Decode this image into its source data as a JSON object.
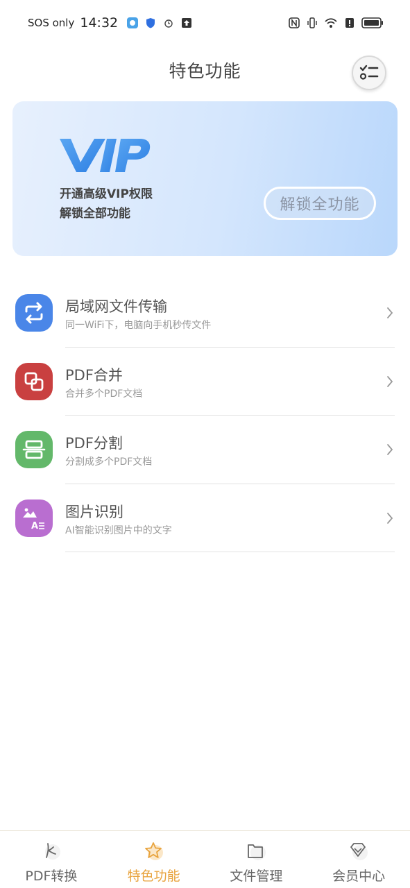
{
  "status_bar": {
    "carrier": "SOS only",
    "time": "14:32"
  },
  "header": {
    "title": "特色功能",
    "task_icon": "checklist-icon"
  },
  "vip_banner": {
    "logo_text": "VIP",
    "line1": "开通高级VIP权限",
    "line2": "解锁全部功能",
    "unlock_label": "解锁全功能"
  },
  "features": [
    {
      "name": "局域网文件传输",
      "desc": "同一WiFi下，电脑向手机秒传文件",
      "icon": "transfer-icon",
      "color": "#4a86e8"
    },
    {
      "name": "PDF合并",
      "desc": "合并多个PDF文档",
      "icon": "merge-icon",
      "color": "#c94040"
    },
    {
      "name": "PDF分割",
      "desc": "分割成多个PDF文档",
      "icon": "split-icon",
      "color": "#63b86a"
    },
    {
      "name": "图片识别",
      "desc": "AI智能识别图片中的文字",
      "icon": "image-ocr-icon",
      "color": "#b96ed0"
    }
  ],
  "bottom_nav": [
    {
      "label": "PDF转换",
      "icon": "pdf-convert-icon",
      "active": false
    },
    {
      "label": "特色功能",
      "icon": "star-icon",
      "active": true
    },
    {
      "label": "文件管理",
      "icon": "folder-icon",
      "active": false
    },
    {
      "label": "会员中心",
      "icon": "diamond-icon",
      "active": false
    }
  ],
  "colors": {
    "accent": "#e8a33d",
    "vip_blue": "#3d8de8"
  }
}
